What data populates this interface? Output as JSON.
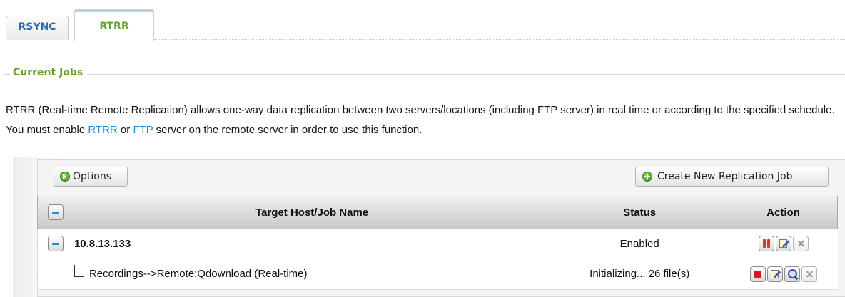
{
  "tabs": [
    {
      "label": "RSYNC",
      "active": false
    },
    {
      "label": "RTRR",
      "active": true
    }
  ],
  "section": {
    "legend": "Current Jobs"
  },
  "description": {
    "part1": "RTRR (Real-time Remote Replication) allows one-way data replication between two servers/locations (including FTP server) in real time or according to the specified schedule. You must enable ",
    "link1": "RTRR",
    "part2": " or ",
    "link2": "FTP",
    "part3": " server on the remote server in order to use this function."
  },
  "toolbar": {
    "options_label": "Options",
    "create_label": "Create New Replication Job"
  },
  "table": {
    "columns": [
      "Target Host/Job Name",
      "Status",
      "Action"
    ],
    "host": {
      "name": "10.8.13.133",
      "status": "Enabled"
    },
    "job": {
      "name": "Recordings-->Remote:Qdownload (Real-time)",
      "status": "Initializing... 26 file(s)"
    }
  },
  "colors": {
    "accent_green": "#6a9a2a",
    "link_blue": "#1a8fd1",
    "tab_blue": "#2a6aa6"
  }
}
